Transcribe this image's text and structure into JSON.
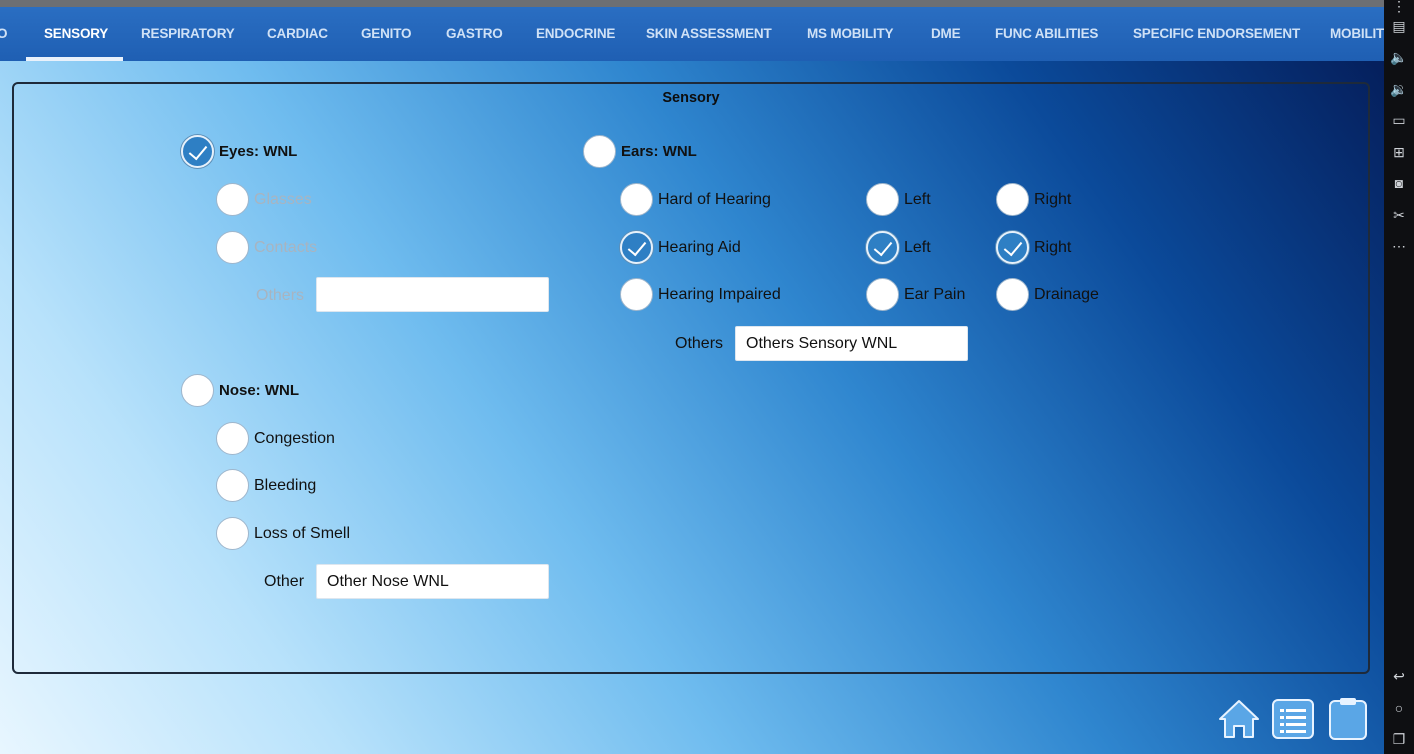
{
  "tabs": [
    {
      "label": "O",
      "active": false
    },
    {
      "label": "SENSORY",
      "active": true
    },
    {
      "label": "RESPIRATORY",
      "active": false
    },
    {
      "label": "CARDIAC",
      "active": false
    },
    {
      "label": "GENITO",
      "active": false
    },
    {
      "label": "GASTRO",
      "active": false
    },
    {
      "label": "ENDOCRINE",
      "active": false
    },
    {
      "label": "SKIN ASSESSMENT",
      "active": false
    },
    {
      "label": "MS MOBILITY",
      "active": false
    },
    {
      "label": "DME",
      "active": false
    },
    {
      "label": "FUNC ABILITIES",
      "active": false
    },
    {
      "label": "SPECIFIC ENDORSEMENT",
      "active": false
    },
    {
      "label": "MOBILIT",
      "active": false
    }
  ],
  "panel": {
    "title": "Sensory"
  },
  "eyes": {
    "wnl": {
      "label": "Eyes: WNL",
      "checked": true
    },
    "glasses": {
      "label": "Glasses",
      "checked": false,
      "disabled": true
    },
    "contacts": {
      "label": "Contacts",
      "checked": false,
      "disabled": true
    },
    "others_label": "Others",
    "others_value": ""
  },
  "ears": {
    "wnl": {
      "label": "Ears: WNL",
      "checked": false
    },
    "hard_of_hearing": {
      "label": "Hard of Hearing",
      "checked": false
    },
    "hoh_left": {
      "label": "Left",
      "checked": false
    },
    "hoh_right": {
      "label": "Right",
      "checked": false
    },
    "hearing_aid": {
      "label": "Hearing Aid",
      "checked": true
    },
    "aid_left": {
      "label": "Left",
      "checked": true
    },
    "aid_right": {
      "label": "Right",
      "checked": true
    },
    "hearing_impaired": {
      "label": "Hearing Impaired",
      "checked": false
    },
    "ear_pain": {
      "label": "Ear Pain",
      "checked": false
    },
    "drainage": {
      "label": "Drainage",
      "checked": false
    },
    "others_label": "Others",
    "others_value": "Others Sensory WNL"
  },
  "nose": {
    "wnl": {
      "label": "Nose: WNL",
      "checked": false
    },
    "congestion": {
      "label": "Congestion",
      "checked": false
    },
    "bleeding": {
      "label": "Bleeding",
      "checked": false
    },
    "loss_of_smell": {
      "label": "Loss of Smell",
      "checked": false
    },
    "other_label": "Other",
    "other_value": "Other Nose WNL"
  },
  "bottom_buttons": [
    "home-icon",
    "list-icon",
    "clipboard-icon"
  ],
  "system_bar_icons": [
    "more-icon",
    "keyboard-icon",
    "volume-up-icon",
    "volume-down-icon",
    "screen-icon",
    "add-screen-icon",
    "camera-icon",
    "cut-icon",
    "ellipsis-icon",
    "back-icon",
    "home-circle-icon",
    "recents-icon"
  ],
  "colors": {
    "accent": "#2e7fc4",
    "tabbar": "#1f5fb3"
  }
}
